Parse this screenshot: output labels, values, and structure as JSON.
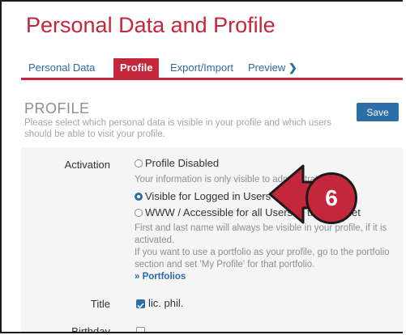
{
  "page_title": "Personal Data and Profile",
  "tabs": [
    {
      "label": "Personal Data"
    },
    {
      "label": "Profile"
    },
    {
      "label": "Export/Import"
    },
    {
      "label": "Preview",
      "chevron": "❯"
    }
  ],
  "section": {
    "heading": "PROFILE",
    "description": "Please select which personal data is visible in your profile and which users should be able to visit your profile.",
    "save_label": "Save"
  },
  "activation": {
    "label": "Activation",
    "options": [
      {
        "label": "Profile Disabled",
        "selected": false
      },
      {
        "label": "Visible for Logged in Users",
        "selected": true
      },
      {
        "label": "WWW / Accessible for all Users of the Internet",
        "selected": false
      }
    ],
    "help_disabled": "Your information is only visible to administrators of",
    "help_www": "First and last name will always be visible in your profile, if it is activated.",
    "help_portfolio": "If you want to use a portfolio as your profile, go to the portfolio section and set 'My Profile' for that portfolio.",
    "portfolios_link": "» Portfolios"
  },
  "title_field": {
    "label": "Title",
    "value": "lic. phil.",
    "checked": true
  },
  "birthday_field": {
    "label": "Birthday",
    "checked": false
  },
  "callout": {
    "number": "6"
  },
  "colors": {
    "accent": "#c4263b",
    "primary": "#2e6ea8",
    "link": "#2a6aa8"
  }
}
